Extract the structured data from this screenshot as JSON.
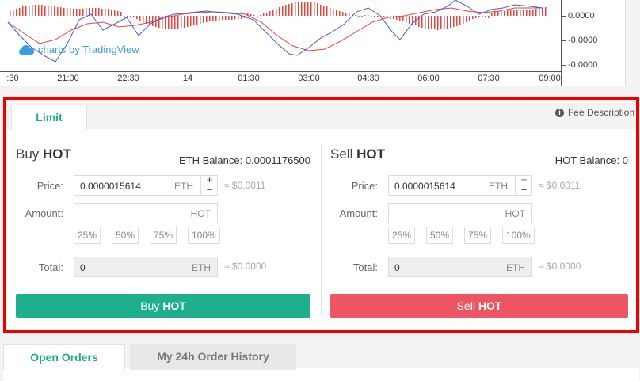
{
  "chart": {
    "brand": "charts by TradingView",
    "y_ticks": [
      "0.0000",
      "-0.0000",
      "-0.0000"
    ],
    "x_ticks": [
      ":30",
      "21:00",
      "22:30",
      "14",
      "01:30",
      "03:00",
      "04:30",
      "06:00",
      "07:30",
      "09:00"
    ],
    "colors": {
      "macd": "#3b5bdb",
      "signal": "#e8433c",
      "hist_pos": "#e8433c"
    }
  },
  "trade": {
    "tab_limit": "Limit",
    "fee_description": "Fee Description",
    "info_icon": "i",
    "buy": {
      "title_prefix": "Buy",
      "title_asset": "HOT",
      "balance": "ETH Balance: 0.0001176500",
      "price_label": "Price:",
      "price_value": "0.0000015614",
      "price_unit": "ETH",
      "price_approx": "≈ $0.0011",
      "amount_label": "Amount:",
      "amount_unit": "HOT",
      "pcts": [
        "25%",
        "50%",
        "75%",
        "100%"
      ],
      "total_label": "Total:",
      "total_value": "0",
      "total_unit": "ETH",
      "total_approx": "≈ $0.0000",
      "button_prefix": "Buy",
      "button_asset": "HOT"
    },
    "sell": {
      "title_prefix": "Sell",
      "title_asset": "HOT",
      "balance": "HOT Balance: 0",
      "price_label": "Price:",
      "price_value": "0.0000015614",
      "price_unit": "ETH",
      "price_approx": "≈ $0.0011",
      "amount_label": "Amount:",
      "amount_unit": "HOT",
      "pcts": [
        "25%",
        "50%",
        "75%",
        "100%"
      ],
      "total_label": "Total:",
      "total_value": "0",
      "total_unit": "ETH",
      "total_approx": "≈ $0.0000",
      "button_prefix": "Sell",
      "button_asset": "HOT"
    },
    "colors": {
      "buy": "#1eb08e",
      "sell": "#ee5563",
      "accent": "#1eac8c",
      "highlight": "#e00000"
    }
  },
  "orders": {
    "tab_open": "Open Orders",
    "tab_history": "My 24h Order History"
  }
}
